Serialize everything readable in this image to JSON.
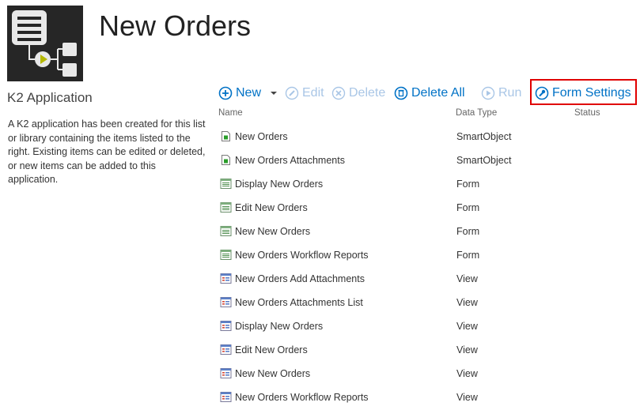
{
  "header": {
    "page_title": "New Orders",
    "app_heading": "K2 Application",
    "app_description": "A K2 application has been created for this list or library containing the items listed to the right. Existing items can be edited or deleted, or new items can be added to this application."
  },
  "toolbar": {
    "new_label": "New",
    "edit_label": "Edit",
    "delete_label": "Delete",
    "delete_all_label": "Delete All",
    "run_label": "Run",
    "form_settings_label": "Form Settings"
  },
  "columns": {
    "name": "Name",
    "data_type": "Data Type",
    "status": "Status"
  },
  "items": [
    {
      "name": "New Orders",
      "type": "SmartObject",
      "icon": "smartobject-icon"
    },
    {
      "name": "New Orders Attachments",
      "type": "SmartObject",
      "icon": "smartobject-icon"
    },
    {
      "name": "Display New Orders",
      "type": "Form",
      "icon": "form-icon"
    },
    {
      "name": "Edit New Orders",
      "type": "Form",
      "icon": "form-icon"
    },
    {
      "name": "New New Orders",
      "type": "Form",
      "icon": "form-icon"
    },
    {
      "name": "New Orders Workflow Reports",
      "type": "Form",
      "icon": "form-icon"
    },
    {
      "name": "New Orders Add Attachments",
      "type": "View",
      "icon": "view-icon"
    },
    {
      "name": "New Orders Attachments List",
      "type": "View",
      "icon": "view-icon"
    },
    {
      "name": "Display New Orders",
      "type": "View",
      "icon": "view-icon"
    },
    {
      "name": "Edit New Orders",
      "type": "View",
      "icon": "view-icon"
    },
    {
      "name": "New New Orders",
      "type": "View",
      "icon": "view-icon"
    },
    {
      "name": "New Orders Workflow Reports",
      "type": "View",
      "icon": "view-icon"
    }
  ],
  "colors": {
    "accent": "#0072c6",
    "disabled": "#a9c6e6",
    "highlight": "#e00000"
  }
}
